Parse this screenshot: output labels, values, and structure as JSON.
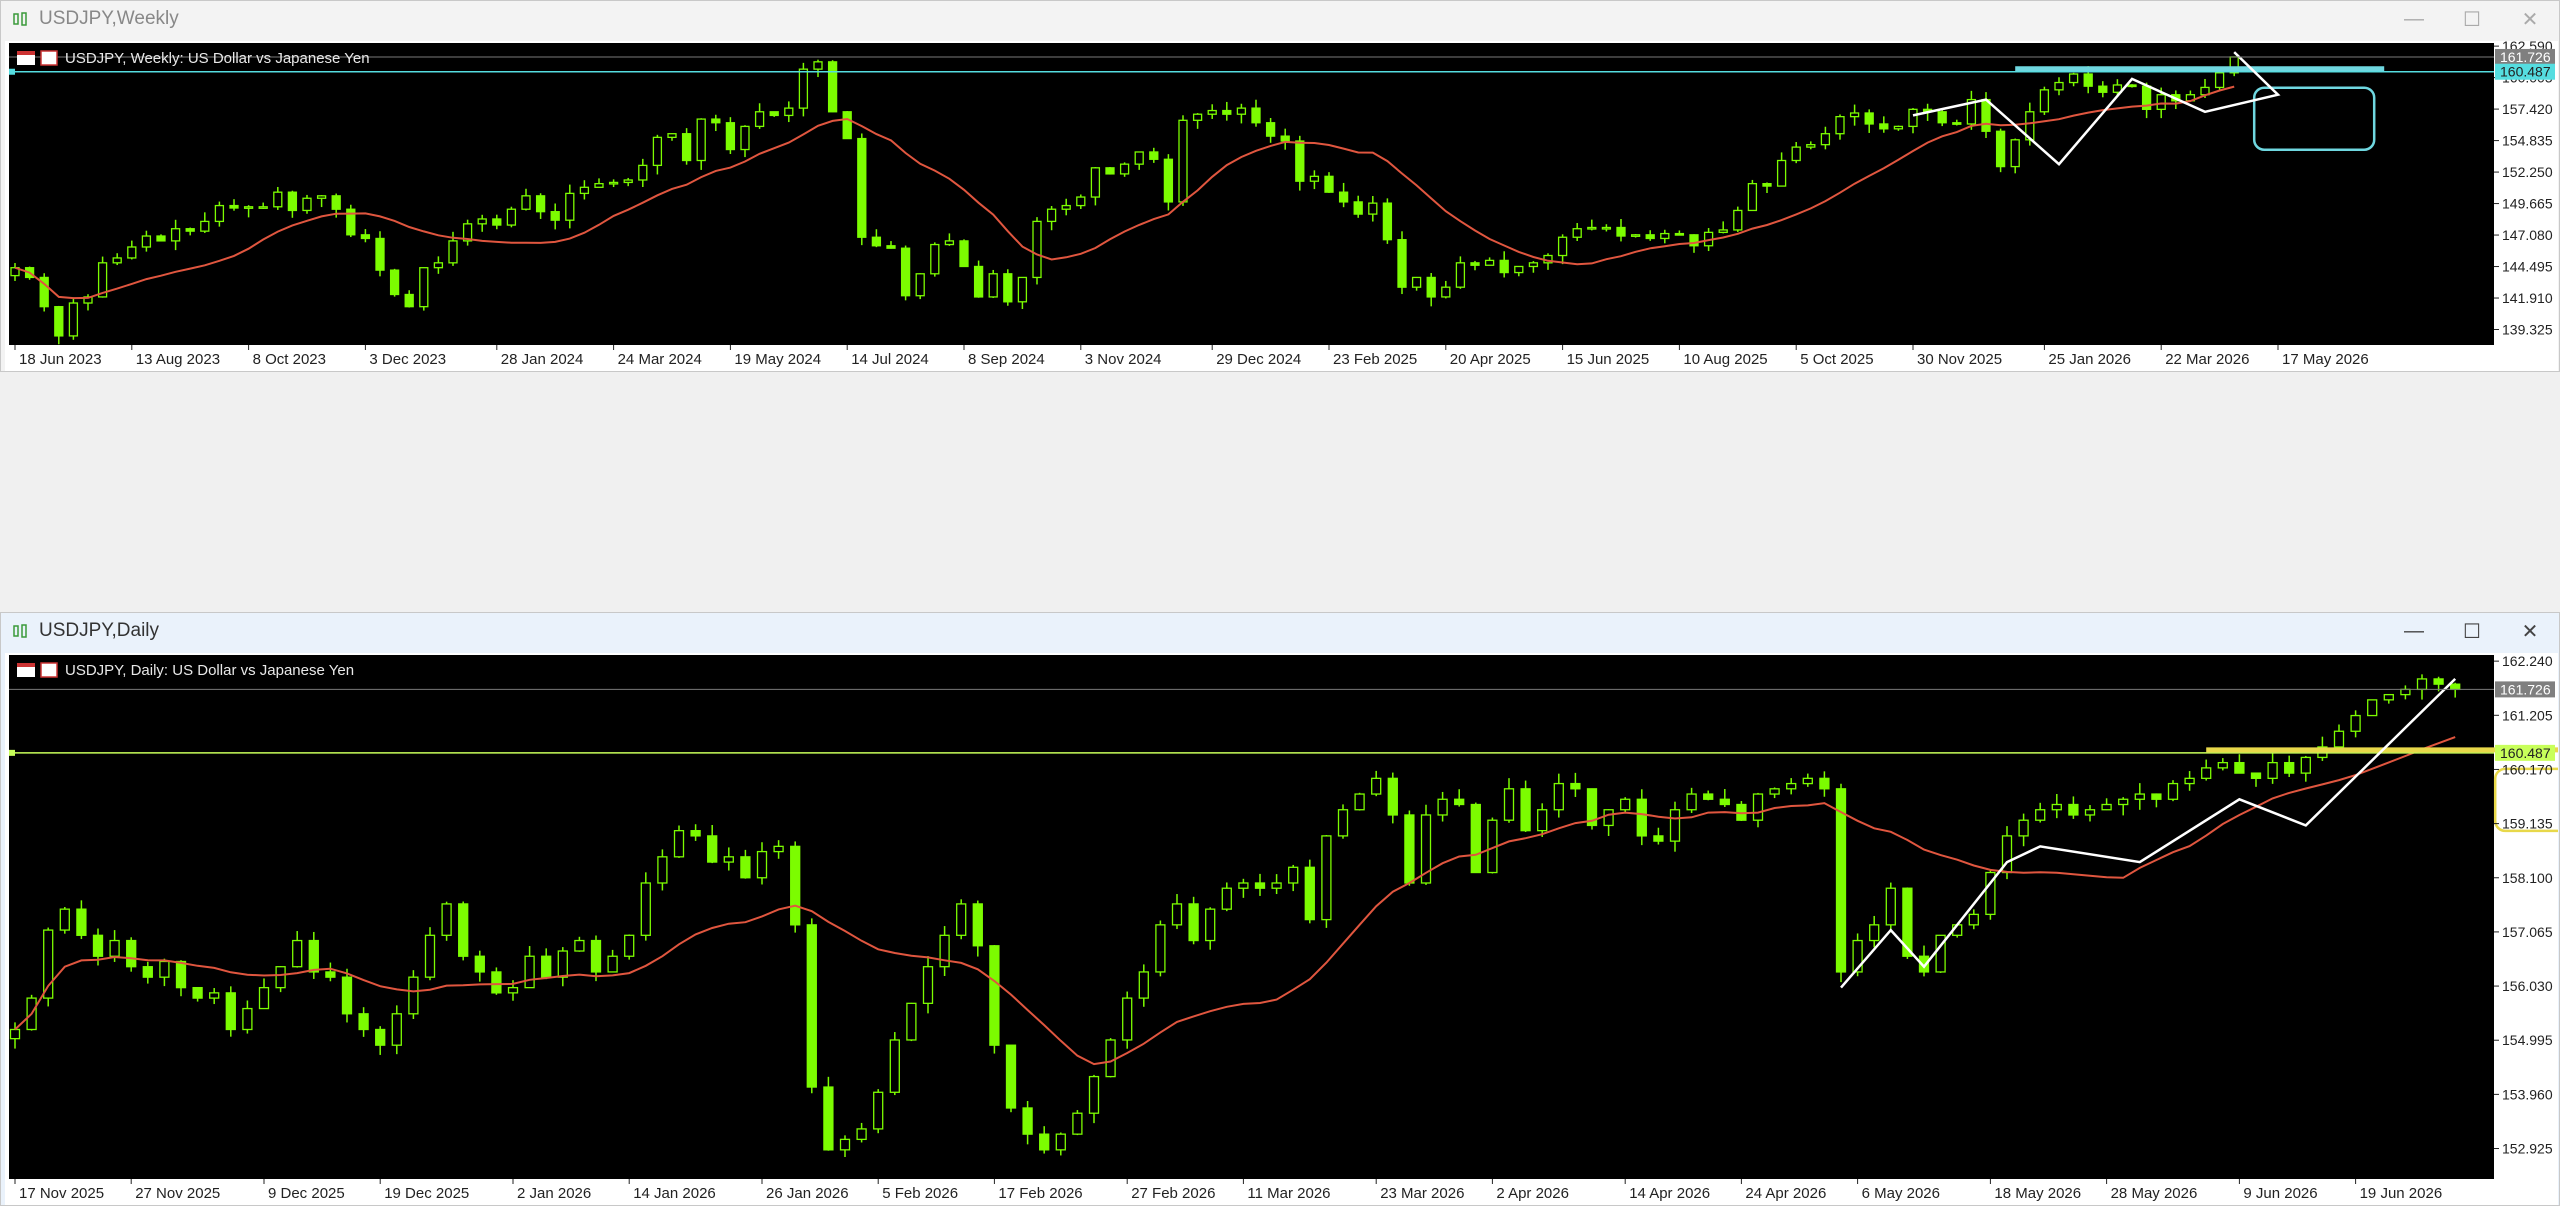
{
  "colors": {
    "bull": "#7CFC00",
    "bear": "#7CFC00",
    "ma": "#e0563f",
    "level_weekly": "#6fd7e0",
    "level_daily": "#e8d84a",
    "hline_weekly": "#55dde0",
    "hline_daily": "#c8ff5a"
  },
  "windows": [
    {
      "title": "USDJPY,Weekly",
      "active": false,
      "chart_label": "USDJPY, Weekly:  US Dollar vs Japanese Yen",
      "price_ticks": [
        "162.590",
        "160.005",
        "157.420",
        "154.835",
        "152.250",
        "149.665",
        "147.080",
        "144.495",
        "141.910",
        "139.325"
      ],
      "current_price": "161.726",
      "level_price": "160.487",
      "date_ticks": [
        "18 Jun 2023",
        "13 Aug 2023",
        "8 Oct 2023",
        "3 Dec 2023",
        "28 Jan 2024",
        "24 Mar 2024",
        "19 May 2024",
        "14 Jul 2024",
        "8 Sep 2024",
        "3 Nov 2024",
        "29 Dec 2024",
        "23 Feb 2025",
        "20 Apr 2025",
        "15 Jun 2025",
        "10 Aug 2025",
        "5 Oct 2025",
        "30 Nov 2025",
        "25 Jan 2026",
        "22 Mar 2026",
        "17 May 2026"
      ]
    },
    {
      "title": "USDJPY,Daily",
      "active": true,
      "chart_label": "USDJPY, Daily:  US Dollar vs Japanese Yen",
      "price_ticks": [
        "162.240",
        "161.205",
        "160.170",
        "159.135",
        "158.100",
        "157.065",
        "156.030",
        "154.995",
        "153.960",
        "152.925"
      ],
      "current_price": "161.726",
      "level_price": "160.487",
      "date_ticks": [
        "17 Nov 2025",
        "27 Nov 2025",
        "9 Dec 2025",
        "19 Dec 2025",
        "2 Jan 2026",
        "14 Jan 2026",
        "26 Jan 2026",
        "5 Feb 2026",
        "17 Feb 2026",
        "27 Feb 2026",
        "11 Mar 2026",
        "23 Mar 2026",
        "2 Apr 2026",
        "14 Apr 2026",
        "24 Apr 2026",
        "6 May 2026",
        "18 May 2026",
        "28 May 2026",
        "9 Jun 2026",
        "19 Jun 2026"
      ]
    }
  ],
  "chart_data": [
    {
      "type": "candlestick",
      "title": "USDJPY, Weekly:  US Dollar vs Japanese Yen",
      "ylim": [
        138.3,
        162.6
      ],
      "x_start": "18 Jun 2023",
      "bar_step": "1 week",
      "close": [
        144.4,
        143.6,
        141.2,
        138.8,
        141.5,
        142.0,
        144.8,
        145.2,
        146.1,
        147.0,
        146.6,
        147.6,
        147.4,
        148.2,
        149.5,
        149.3,
        149.4,
        149.4,
        150.6,
        149.1,
        150.1,
        150.3,
        149.2,
        147.1,
        146.8,
        144.2,
        142.2,
        141.2,
        144.4,
        144.8,
        146.6,
        148.0,
        148.4,
        147.9,
        149.2,
        150.3,
        149.0,
        148.3,
        150.5,
        151.0,
        151.3,
        151.4,
        151.6,
        152.8,
        155.1,
        155.4,
        153.2,
        156.6,
        156.3,
        154.1,
        156.0,
        157.2,
        156.9,
        157.5,
        160.7,
        161.3,
        157.2,
        155.0,
        146.9,
        146.2,
        146.0,
        142.1,
        143.9,
        146.3,
        146.6,
        144.5,
        142.0,
        143.9,
        141.6,
        143.6,
        148.2,
        149.2,
        149.5,
        150.2,
        152.6,
        152.1,
        152.9,
        153.9,
        153.3,
        149.8,
        156.5,
        157.0,
        157.3,
        157.0,
        157.5,
        156.3,
        155.2,
        154.8,
        151.5,
        151.9,
        150.6,
        149.8,
        148.8,
        149.7,
        146.7,
        142.8,
        143.6,
        142.0,
        142.8,
        144.8,
        144.6,
        145.0,
        144.0,
        144.5,
        144.8,
        145.4,
        146.9,
        147.6,
        147.7,
        147.7,
        147.0,
        147.1,
        146.8,
        147.2,
        147.1,
        146.2,
        147.3,
        147.5,
        149.1,
        151.3,
        151.1,
        153.2,
        154.3,
        154.5,
        155.4,
        156.8,
        157.1,
        156.2,
        155.8,
        156.0,
        157.4,
        157.2,
        156.3,
        156.2,
        158.2,
        155.6,
        152.7,
        154.9,
        157.2,
        159.0,
        159.6,
        160.3,
        159.3,
        158.8,
        159.4,
        159.3,
        157.4,
        158.6,
        158.1,
        158.6,
        159.2,
        160.4,
        161.7
      ],
      "ma_sample": [
        {
          "x": "18 Jun 2023",
          "y": 138.5
        },
        {
          "x": "8 Oct 2023",
          "y": 143.0
        },
        {
          "x": "3 Dec 2023",
          "y": 147.6
        },
        {
          "x": "24 Mar 2024",
          "y": 147.9
        },
        {
          "x": "14 Jul 2024",
          "y": 154.4
        },
        {
          "x": "3 Nov 2024",
          "y": 149.6
        },
        {
          "x": "29 Dec 2024",
          "y": 153.4
        },
        {
          "x": "20 Apr 2025",
          "y": 150.5
        },
        {
          "x": "15 Jun 2025",
          "y": 145.5
        },
        {
          "x": "10 Aug 2025",
          "y": 145.5
        },
        {
          "x": "30 Nov 2025",
          "y": 150.5
        },
        {
          "x": "22 Mar 2026",
          "y": 157.6
        },
        {
          "x": "17 May 2026",
          "y": 158.7
        }
      ],
      "levels": [
        160.487
      ]
    },
    {
      "type": "candlestick",
      "title": "USDJPY, Daily:  US Dollar vs Japanese Yen",
      "ylim": [
        152.4,
        162.3
      ],
      "x_start": "17 Nov 2025",
      "bar_step": "1 trading day",
      "close": [
        155.2,
        155.8,
        157.1,
        157.5,
        157.0,
        156.6,
        156.9,
        156.4,
        156.2,
        156.5,
        156.0,
        155.8,
        155.9,
        155.2,
        155.6,
        156.0,
        156.4,
        156.9,
        156.3,
        156.2,
        155.5,
        155.2,
        154.9,
        155.5,
        156.2,
        157.0,
        157.6,
        156.6,
        156.3,
        155.9,
        156.0,
        156.6,
        156.2,
        156.7,
        156.9,
        156.3,
        156.6,
        157.0,
        158.0,
        158.5,
        159.0,
        158.9,
        158.4,
        158.5,
        158.1,
        158.6,
        158.7,
        157.2,
        154.1,
        152.9,
        153.1,
        153.3,
        154.0,
        155.0,
        155.7,
        156.4,
        157.0,
        157.6,
        156.8,
        154.9,
        153.7,
        153.2,
        152.9,
        153.2,
        153.6,
        154.3,
        155.0,
        155.8,
        156.3,
        157.2,
        157.6,
        156.9,
        157.5,
        157.9,
        158.0,
        157.9,
        158.0,
        158.3,
        157.3,
        158.9,
        159.4,
        159.7,
        160.0,
        159.3,
        158.0,
        159.3,
        159.6,
        159.5,
        158.2,
        159.2,
        159.8,
        159.0,
        159.4,
        159.9,
        159.8,
        159.1,
        159.4,
        159.6,
        158.9,
        158.8,
        159.4,
        159.7,
        159.6,
        159.5,
        159.2,
        159.7,
        159.8,
        159.9,
        160.0,
        159.8,
        156.3,
        156.9,
        157.2,
        157.9,
        156.6,
        156.3,
        157.0,
        157.2,
        157.4,
        158.2,
        158.9,
        159.2,
        159.4,
        159.5,
        159.3,
        159.4,
        159.5,
        159.6,
        159.7,
        159.6,
        159.9,
        160.0,
        160.2,
        160.3,
        160.1,
        160.0,
        160.3,
        160.1,
        160.4,
        160.6,
        160.9,
        161.2,
        161.5,
        161.6,
        161.7,
        161.9,
        161.8,
        161.7
      ],
      "ma_sample": [
        {
          "x": "17 Nov 2025",
          "y": 152.7
        },
        {
          "x": "9 Dec 2025",
          "y": 155.7
        },
        {
          "x": "2 Jan 2026",
          "y": 156.6
        },
        {
          "x": "14 Jan 2026",
          "y": 157.2
        },
        {
          "x": "5 Feb 2026",
          "y": 156.8
        },
        {
          "x": "17 Feb 2026",
          "y": 154.9
        },
        {
          "x": "11 Mar 2026",
          "y": 158.0
        },
        {
          "x": "2 Apr 2026",
          "y": 159.4
        },
        {
          "x": "24 Apr 2026",
          "y": 159.3
        },
        {
          "x": "18 May 2026",
          "y": 158.4
        },
        {
          "x": "28 May 2026",
          "y": 158.5
        },
        {
          "x": "9 Jun 2026",
          "y": 159.7
        },
        {
          "x": "19 Jun 2026",
          "y": 160.5
        }
      ],
      "levels": [
        160.487
      ]
    }
  ]
}
